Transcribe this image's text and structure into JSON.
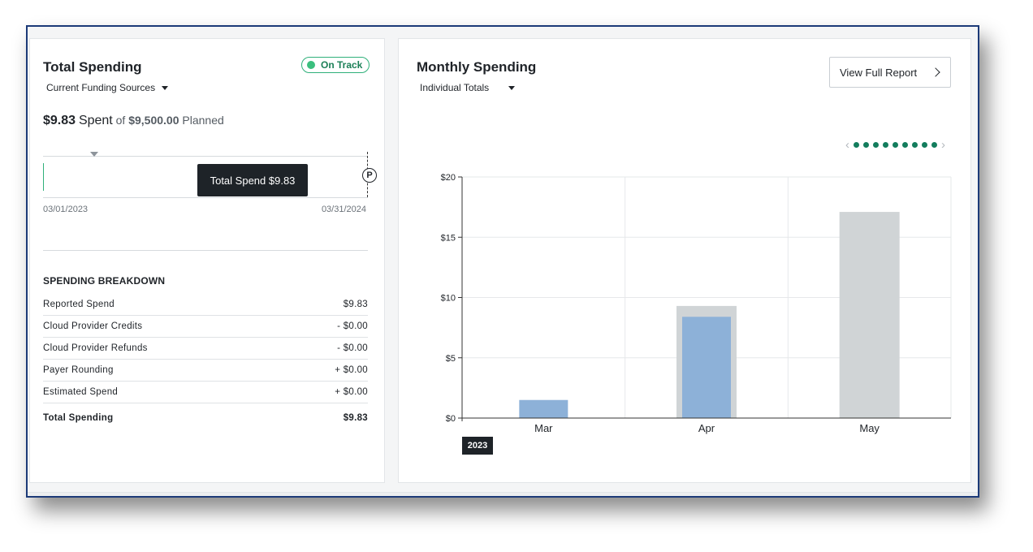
{
  "total_spending": {
    "title": "Total Spending",
    "status_badge": "On Track",
    "funding_dropdown": "Current Funding Sources",
    "spent_amount": "$9.83",
    "spent_word": "Spent",
    "of_word": "of",
    "planned_amount": "$9,500.00",
    "planned_word": "Planned",
    "tooltip": "Total Spend $9.83",
    "planned_marker": "P",
    "start_date": "03/01/2023",
    "end_date": "03/31/2024",
    "breakdown_title": "SPENDING BREAKDOWN",
    "breakdown": [
      {
        "label": "Reported Spend",
        "value": "$9.83"
      },
      {
        "label": "Cloud Provider Credits",
        "value": "- $0.00"
      },
      {
        "label": "Cloud Provider Refunds",
        "value": "- $0.00"
      },
      {
        "label": "Payer Rounding",
        "value": "+ $0.00"
      },
      {
        "label": "Estimated Spend",
        "value": "+ $0.00"
      }
    ],
    "total_label": "Total Spending",
    "total_value": "$9.83"
  },
  "monthly_spending": {
    "title": "Monthly Spending",
    "totals_dropdown": "Individual Totals",
    "view_report_label": "View Full Report",
    "pager": {
      "prev": "‹",
      "next": "›",
      "dot_count": 9
    },
    "year_label": "2023"
  },
  "colors": {
    "actual_bar": "#8db1d8",
    "forecast_bar": "#d0d4d6",
    "accent_green": "#137d5d"
  },
  "chart_data": {
    "type": "bar",
    "categories": [
      "Mar",
      "Apr",
      "May"
    ],
    "series": [
      {
        "values": [
          0,
          9.3,
          17.1
        ]
      },
      {
        "values": [
          1.5,
          8.4,
          0
        ]
      }
    ],
    "ylim": [
      0,
      20
    ],
    "yticks": [
      0,
      5,
      10,
      15,
      20
    ],
    "ytick_labels": [
      "$0",
      "$5",
      "$10",
      "$15",
      "$20"
    ],
    "grid": true
  }
}
